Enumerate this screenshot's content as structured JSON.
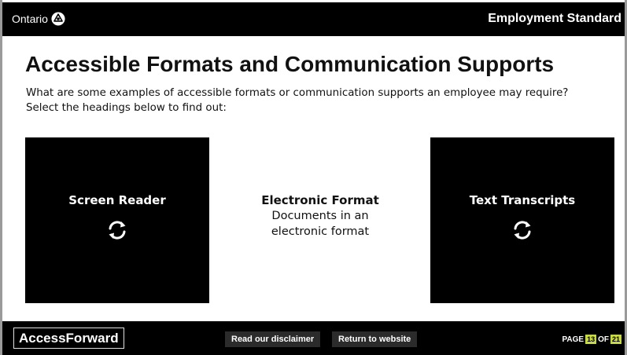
{
  "header": {
    "logo_text": "Ontario",
    "course_title": "Employment Standard"
  },
  "main": {
    "title": "Accessible Formats and Communication Supports",
    "intro_line1": "What are some examples of accessible formats or communication supports an employee may require?",
    "intro_line2": "Select the headings below to find out:"
  },
  "cards": {
    "left_title": "Screen Reader",
    "middle_title": "Electronic Format",
    "middle_text": "Documents in an electronic format",
    "right_title": "Text Transcripts"
  },
  "footer": {
    "brand": "AccessForward",
    "disclaimer_label": "Read our disclaimer",
    "return_label": "Return to website",
    "page_label": "PAGE",
    "page_current": "13",
    "of_label": "OF",
    "page_total": "21"
  },
  "colors": {
    "header_bg": "#000000",
    "card_bg": "#000000",
    "page_badge": "#c9d846"
  },
  "icons": [
    "ontario-trillium-icon",
    "flip-card-icon"
  ]
}
